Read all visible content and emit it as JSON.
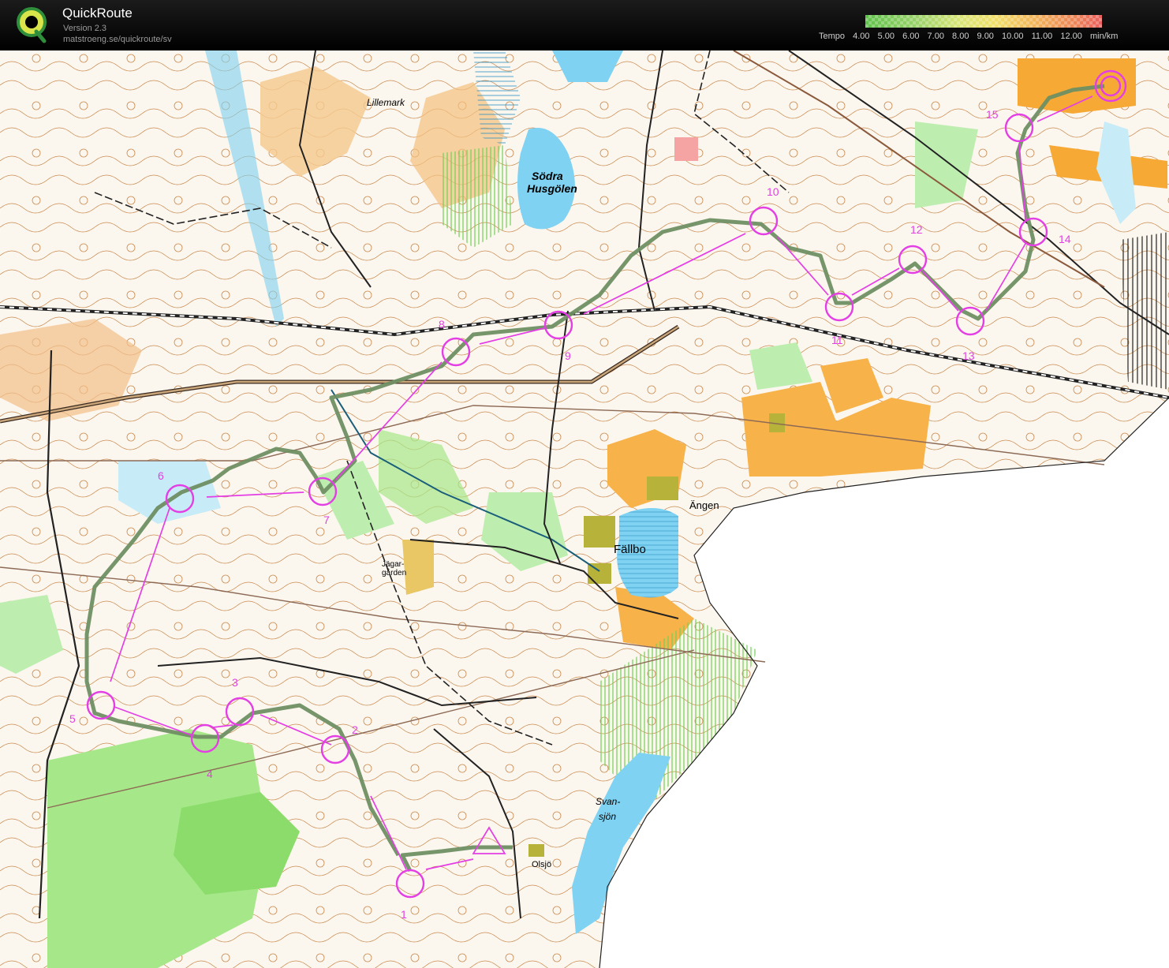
{
  "app": {
    "title": "QuickRoute",
    "version": "Version 2.3",
    "url": "matstroeng.se/quickroute/sv",
    "logo_letter": "Q"
  },
  "legend": {
    "label": "Tempo",
    "values": [
      "4.00",
      "5.00",
      "6.00",
      "7.00",
      "8.00",
      "9.00",
      "10.00",
      "11.00",
      "12.00"
    ],
    "unit": "min/km"
  },
  "map": {
    "place_names": {
      "lillemark": "Lillemark",
      "sodra_husgolen_1": "Södra",
      "sodra_husgolen_2": "Husgölen",
      "angen": "Ängen",
      "fallbo": "Fällbo",
      "jagargarden_1": "Jägar-",
      "jagargarden_2": "gården",
      "svansjon_1": "Svan-",
      "svansjon_2": "sjön",
      "olsjo": "Olsjö"
    },
    "controls": [
      "1",
      "2",
      "3",
      "4",
      "5",
      "6",
      "7",
      "8",
      "9",
      "10",
      "11",
      "12",
      "13",
      "14",
      "15"
    ],
    "colors": {
      "course": "#e43fe4",
      "route": "#6f8f63",
      "water": "#7fd2f2",
      "open_land": "#f7b24a",
      "green": "#8bdc6a",
      "contour": "#c46a2a"
    }
  }
}
